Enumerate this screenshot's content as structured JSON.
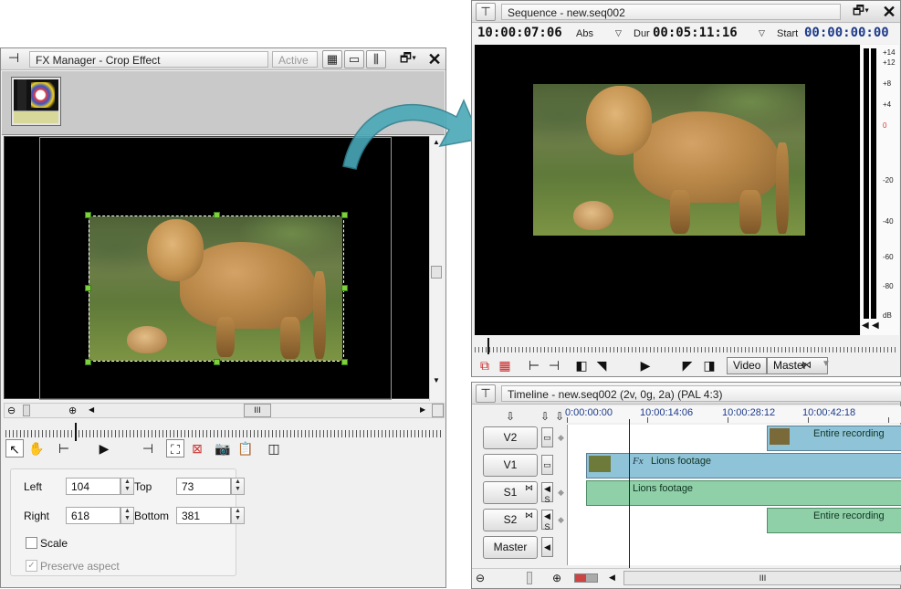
{
  "fx": {
    "title": "FX Manager - Crop Effect",
    "status": "Active",
    "crop": {
      "left_label": "Left",
      "left_value": "104",
      "top_label": "Top",
      "top_value": "73",
      "right_label": "Right",
      "right_value": "618",
      "bottom_label": "Bottom",
      "bottom_value": "381",
      "scale_label": "Scale",
      "preserve_label": "Preserve aspect"
    },
    "hscroll_grip": "III"
  },
  "sequence": {
    "title": "Sequence - new.seq002",
    "timecode": "10:00:07:06",
    "abs_label": "Abs",
    "dur_label": "Dur",
    "duration": "00:05:11:16",
    "start_label": "Start",
    "start_value": "00:00:00:00",
    "video_btn": "Video",
    "master_btn": "Master",
    "meter_labels": [
      "+14",
      "+12",
      "+8",
      "+4",
      "0",
      "-20",
      "-40",
      "-60",
      "-80",
      "dB"
    ]
  },
  "timeline": {
    "title": "Timeline - new.seq002 (2v, 0g, 2a) (PAL 4:3)",
    "ruler": [
      "0:00:00:00",
      "10:00:14:06",
      "10:00:28:12",
      "10:00:42:18"
    ],
    "tracks": [
      {
        "name": "V2",
        "clip": "Entire recording"
      },
      {
        "name": "V1",
        "clip": "Lions footage"
      },
      {
        "name": "S1",
        "clip": "Lions footage"
      },
      {
        "name": "S2",
        "clip": "Entire recording"
      },
      {
        "name": "Master"
      }
    ],
    "fx_badge": "Fx",
    "solo_label": "S",
    "hscroll_grip": "III"
  },
  "colors": {
    "clip_video": "#8fc4d8",
    "clip_audio": "#8fd0a8",
    "handle": "#7cd13c",
    "arrow": "#4aa8b8",
    "timecode_blue": "#1c3a8a"
  }
}
